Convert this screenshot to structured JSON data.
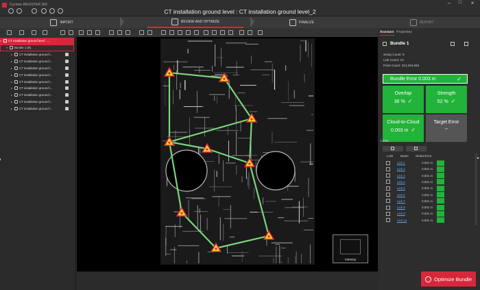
{
  "app": {
    "title": "Cyclone REGISTER 360",
    "window_title": "CT installation ground level : CT installation ground level_2"
  },
  "steps": [
    {
      "label": "IMPORT",
      "icon": "import-icon"
    },
    {
      "label": "REVIEW AND OPTIMIZE",
      "icon": "review-optimize-icon"
    },
    {
      "label": "FINALIZE",
      "icon": "finalize-icon"
    },
    {
      "label": "REPORT",
      "icon": "report-icon"
    }
  ],
  "tree": {
    "project": "CT installation ground level : ...",
    "bundle": "Bundle 1 (9)",
    "items": [
      "CT installation ground l...",
      "CT installation ground l...",
      "CT installation ground l...",
      "CT installation ground l...",
      "CT installation ground l...",
      "CT installation ground l...",
      "CT installation ground l...",
      "CT installation ground l...",
      "CT installation ground l..."
    ]
  },
  "viewport": {
    "sitemap_label": "SiteMap"
  },
  "right": {
    "tabs": [
      "Assistant",
      "Properties"
    ],
    "bundle_title": "Bundle 1",
    "stats": [
      {
        "label": "Setup Count:",
        "value": "9"
      },
      {
        "label": "Link Count:",
        "value": "10"
      },
      {
        "label": "Point Count:",
        "value": "313,284,656"
      }
    ],
    "bundle_error": "Bundle Error 0.003 m",
    "tiles": [
      {
        "title": "Overlap",
        "value": "36 %",
        "check": "✓",
        "color": "#22b33a"
      },
      {
        "title": "Strength",
        "value": "52 %",
        "check": "✓",
        "color": "#22b33a"
      },
      {
        "title": "Cloud-to-Cloud",
        "value": "0.003 m",
        "check": "✓",
        "color": "#22b33a"
      },
      {
        "title": "Target Error",
        "value": "--",
        "check": "",
        "color": "#555555"
      }
    ],
    "links_title": "Links",
    "links_headers": [
      "Lock",
      "Name",
      "Global Error"
    ],
    "links": [
      {
        "name": "Link 1",
        "error": "0.001 m"
      },
      {
        "name": "Link 2",
        "error": "0.001 m"
      },
      {
        "name": "Link 3",
        "error": "0.001 m"
      },
      {
        "name": "Link 4",
        "error": "0.001 m"
      },
      {
        "name": "Link 5",
        "error": "0.001 m"
      },
      {
        "name": "Link 6",
        "error": "0.001 m"
      },
      {
        "name": "Link 7",
        "error": "0.001 m"
      },
      {
        "name": "Link 8",
        "error": "0.001 m"
      },
      {
        "name": "Link 9",
        "error": "0.001 m"
      },
      {
        "name": "Link 10",
        "error": "0.001 m"
      }
    ],
    "optimize_label": "Optimize Bundle"
  },
  "colors": {
    "accent": "#d6283b",
    "good": "#22b33a",
    "link_line": "#7cd67c"
  }
}
